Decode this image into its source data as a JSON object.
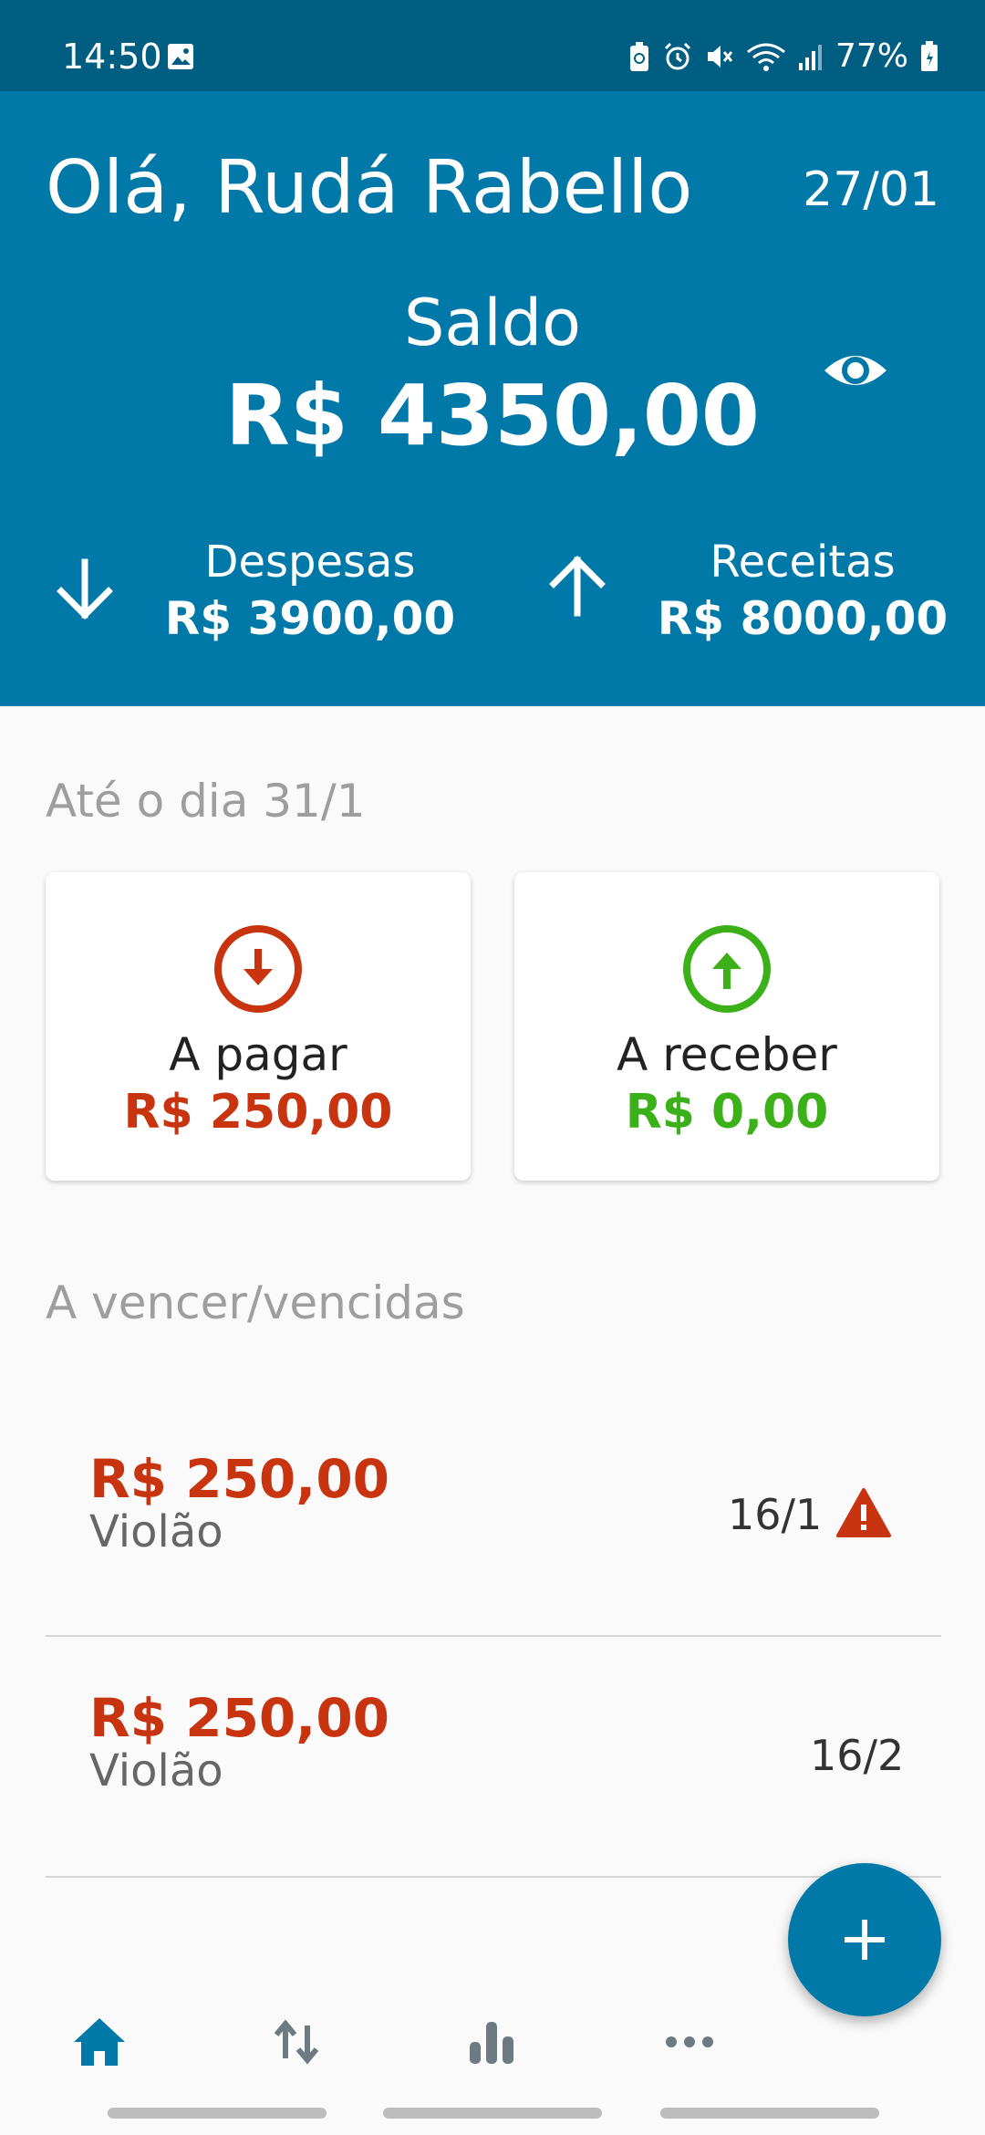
{
  "status_bar": {
    "time": "14:50",
    "battery": "77%",
    "icons": [
      "image-icon",
      "battery-saver-icon",
      "alarm-icon",
      "mute-icon",
      "wifi-icon",
      "signal-icon",
      "battery-icon"
    ]
  },
  "header": {
    "greeting": "Olá, Rudá Rabello",
    "date": "27/01",
    "balance_label": "Saldo",
    "balance_value": "R$ 4350,00",
    "expenses_label": "Despesas",
    "expenses_value": "R$ 3900,00",
    "income_label": "Receitas",
    "income_value": "R$ 8000,00",
    "visibility_icon": "eye-icon"
  },
  "summary": {
    "section_title": "Até o dia 31/1",
    "to_pay_label": "A pagar",
    "to_pay_value": "R$ 250,00",
    "to_receive_label": "A receber",
    "to_receive_value": "R$ 0,00"
  },
  "bills": {
    "section_title": "A vencer/vencidas",
    "items": [
      {
        "amount": "R$ 250,00",
        "name": "Violão",
        "date": "16/1",
        "overdue": true
      },
      {
        "amount": "R$ 250,00",
        "name": "Violão",
        "date": "16/2",
        "overdue": false
      }
    ]
  },
  "nav": {
    "items": [
      "home-icon",
      "transfer-icon",
      "chart-icon",
      "more-icon"
    ],
    "active": "home-icon"
  },
  "colors": {
    "status_bar": "#005e83",
    "primary": "#0079a8",
    "expense_red": "#c8340f",
    "income_green": "#3cb018",
    "background": "#fafafa"
  }
}
